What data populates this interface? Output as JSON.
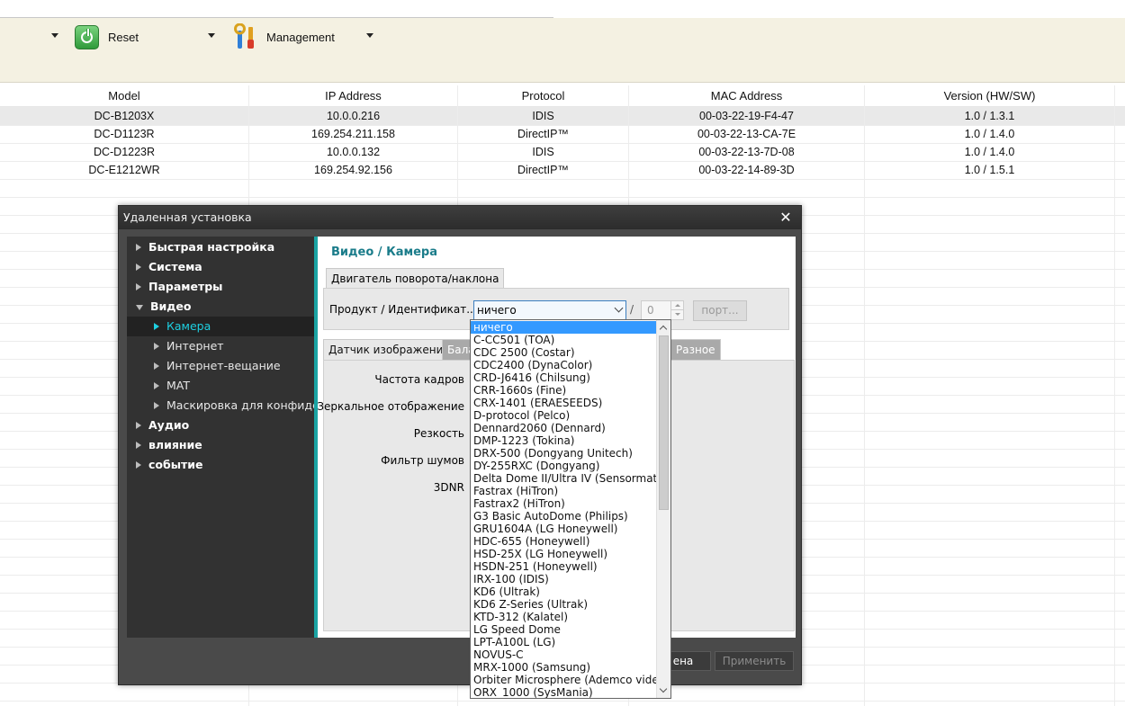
{
  "toolbar": {
    "reset_label": "Reset",
    "management_label": "Management",
    "reset_icon": "power-reset-icon",
    "management_icon": "tools-icon"
  },
  "table": {
    "columns": [
      "Model",
      "IP Address",
      "Protocol",
      "MAC Address",
      "Version (HW/SW)"
    ],
    "rows": [
      [
        "DC-B1203X",
        "10.0.0.216",
        "IDIS",
        "00-03-22-19-F4-47",
        "1.0 / 1.3.1"
      ],
      [
        "DC-D1123R",
        "169.254.211.158",
        "DirectIP™",
        "00-03-22-13-CA-7E",
        "1.0 / 1.4.0"
      ],
      [
        "DC-D1223R",
        "10.0.0.132",
        "IDIS",
        "00-03-22-13-7D-08",
        "1.0 / 1.4.0"
      ],
      [
        "DC-E1212WR",
        "169.254.92.156",
        "DirectIP™",
        "00-03-22-14-89-3D",
        "1.0 / 1.5.1"
      ]
    ]
  },
  "dialog": {
    "title": "Удаленная установка",
    "close_icon": "close-icon",
    "nav": [
      {
        "label": "Быстрая настройка",
        "level": 0,
        "expanded": false
      },
      {
        "label": "Система",
        "level": 0,
        "expanded": false
      },
      {
        "label": "Параметры",
        "level": 0,
        "expanded": false
      },
      {
        "label": "Видео",
        "level": 0,
        "expanded": true
      },
      {
        "label": "Камера",
        "level": 1,
        "active": true
      },
      {
        "label": "Интернет",
        "level": 1
      },
      {
        "label": "Интернет-вещание",
        "level": 1
      },
      {
        "label": "MAT",
        "level": 1
      },
      {
        "label": "Маскировка для конфиденциальности",
        "level": 1
      },
      {
        "label": "Аудио",
        "level": 0,
        "expanded": false
      },
      {
        "label": "влияние",
        "level": 0,
        "expanded": false
      },
      {
        "label": "событие",
        "level": 0,
        "expanded": false
      }
    ],
    "content_title": "Видео / Камера",
    "ptz_tab": "Двигатель поворота/наклона",
    "product_label": "Продукт / Идентификат...",
    "product_value": "ничего",
    "id_separator": "/",
    "id_value": "0",
    "port_button": "порт...",
    "tabs": [
      "Датчик изображения",
      "Бала",
      "Разное"
    ],
    "fields": [
      "Частота кадров",
      "Зеркальное отображение",
      "Резкость",
      "Фильтр шумов",
      "3DNR"
    ],
    "ok_partial": "ена",
    "apply_button": "Применить"
  },
  "dropdown": {
    "selected_index": 0,
    "options": [
      "ничего",
      "C-CC501 (TOA)",
      "CDC 2500 (Costar)",
      "CDC2400 (DynaColor)",
      "CRD-J6416 (Chilsung)",
      "CRR-1660s (Fine)",
      "CRX-1401 (ERAESEEDS)",
      "D-protocol (Pelco)",
      "Dennard2060 (Dennard)",
      "DMP-1223 (Tokina)",
      "DRX-500 (Dongyang Unitech)",
      "DY-255RXC (Dongyang)",
      "Delta Dome II/Ultra IV (Sensormatic)",
      "Fastrax (HiTron)",
      "Fastrax2 (HiTron)",
      "G3 Basic AutoDome (Philips)",
      "GRU1604A (LG Honeywell)",
      "HDC-655 (Honeywell)",
      "HSD-25X (LG Honeywell)",
      "HSDN-251 (Honeywell)",
      "IRX-100 (IDIS)",
      "KD6 (Ultrak)",
      "KD6 Z-Series (Ultrak)",
      "KTD-312 (Kalatel)",
      "LG Speed Dome",
      "LPT-A100L (LG)",
      "NOVUS-C",
      "MRX-1000 (Samsung)",
      "Orbiter Microsphere (Ademco video)",
      "ORX_1000 (SysMania)"
    ]
  }
}
